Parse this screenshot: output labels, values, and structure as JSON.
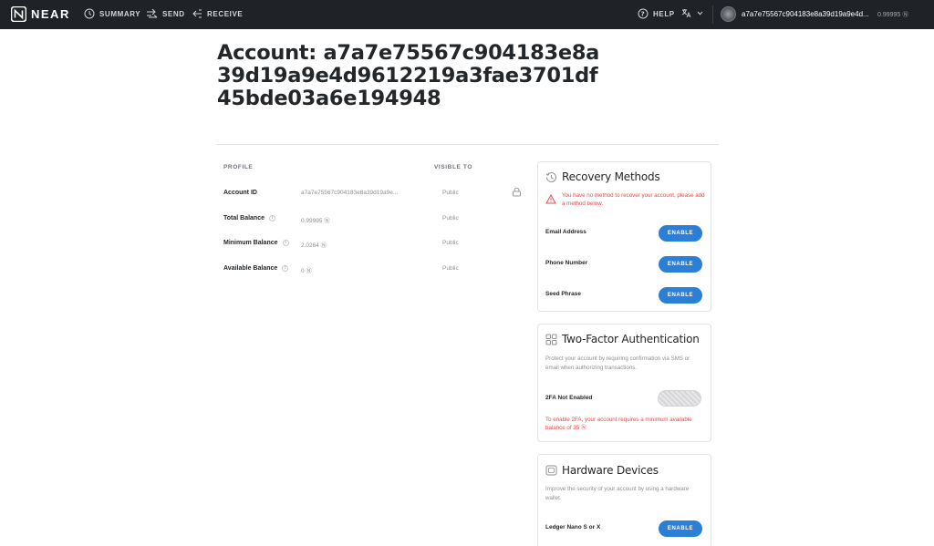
{
  "nav": {
    "brand": "NEAR",
    "summary": "SUMMARY",
    "send": "SEND",
    "receive": "RECEIVE",
    "help": "HELP",
    "account_name": "a7a7e75567c904183e8a39d19a9e4d...",
    "account_balance": "0.99995 Ⓝ"
  },
  "page": {
    "title": "Account: a7a7e75567c904183e8a39d19a9e4d9612219a3fae3701df45bde03a6e194948"
  },
  "profile": {
    "header_profile": "PROFILE",
    "header_visible": "VISIBLE TO",
    "rows": [
      {
        "label": "Account ID",
        "value": "a7a7e75567c904183e8a39d19a9e...",
        "visibility": "Public"
      },
      {
        "label": "Total Balance",
        "value": "0.99995 Ⓝ",
        "visibility": "Public"
      },
      {
        "label": "Minimum Balance",
        "value": "2.0264 Ⓝ",
        "visibility": "Public"
      },
      {
        "label": "Available Balance",
        "value": "0 Ⓝ",
        "visibility": "Public"
      }
    ]
  },
  "recovery": {
    "title": "Recovery Methods",
    "warning": "You have no method to recover your account, please add a method below.",
    "methods": [
      {
        "label": "Email Address",
        "button": "ENABLE"
      },
      {
        "label": "Phone Number",
        "button": "ENABLE"
      },
      {
        "label": "Seed Phrase",
        "button": "ENABLE"
      }
    ]
  },
  "twofa": {
    "title": "Two-Factor Authentication",
    "description": "Protect your account by requiring confirmation via SMS or email when authorizing transactions.",
    "status_label": "2FA Not Enabled",
    "requirement": "To enable 2FA, your account requires a minimum available balance of 35 Ⓝ"
  },
  "hardware": {
    "title": "Hardware Devices",
    "description": "Improve the security of your account by using a hardware wallet.",
    "device_label": "Ledger Nano S or X",
    "button": "ENABLE"
  },
  "colors": {
    "topbar": "#1f2227",
    "accent_blue": "#2c7fd6",
    "warning_red": "#e5484d"
  }
}
